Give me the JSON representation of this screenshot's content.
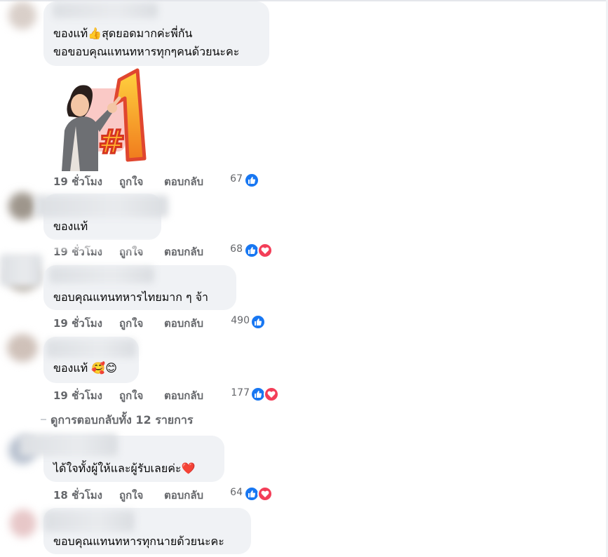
{
  "comments": [
    {
      "id": "c1",
      "text_lines": [
        "ของแท้👍สุดยอดมากค่ะพี่กัน",
        "ขอขอบคุณแทนทหารทุกๆคนด้วยนะคะ"
      ],
      "time": "19 ชั่วโมง",
      "like": "ถูกใจ",
      "reply": "ตอบกลับ",
      "count": "67",
      "reactions": [
        "like"
      ],
      "has_sticker": true
    },
    {
      "id": "c2",
      "text_lines": [
        "ของแท้"
      ],
      "time": "19 ชั่วโมง",
      "like": "ถูกใจ",
      "reply": "ตอบกลับ",
      "count": "68",
      "reactions": [
        "like",
        "love"
      ]
    },
    {
      "id": "c3",
      "text_lines": [
        "ขอบคุณแทนทหารไทยมาก ๆ จ้า"
      ],
      "time": "19 ชั่วโมง",
      "like": "ถูกใจ",
      "reply": "ตอบกลับ",
      "count": "490",
      "reactions": [
        "like"
      ]
    },
    {
      "id": "c4",
      "text_lines": [
        "ของแท้ 🥰😊"
      ],
      "time": "19 ชั่วโมง",
      "like": "ถูกใจ",
      "reply": "ตอบกลับ",
      "count": "177",
      "reactions": [
        "like",
        "love"
      ]
    },
    {
      "id": "c5",
      "text_lines": [
        "ได้ใจทั้งผู้ให้และผู้รับเลยค่ะ❤️"
      ],
      "time": "18 ชั่วโมง",
      "like": "ถูกใจ",
      "reply": "ตอบกลับ",
      "count": "64",
      "reactions": [
        "like",
        "love"
      ]
    },
    {
      "id": "c6",
      "text_lines": [
        "ขอบคุณแทนทหารทุกนายด้วยนะคะ"
      ]
    }
  ],
  "view_replies": "ดูการตอบกลับทั้ง 12 รายการ",
  "colors": {
    "like": "#1877f2",
    "love": "#f33e58",
    "bubble": "#f0f2f5",
    "meta": "#65676b"
  },
  "sticker": {
    "badge": "#1"
  }
}
